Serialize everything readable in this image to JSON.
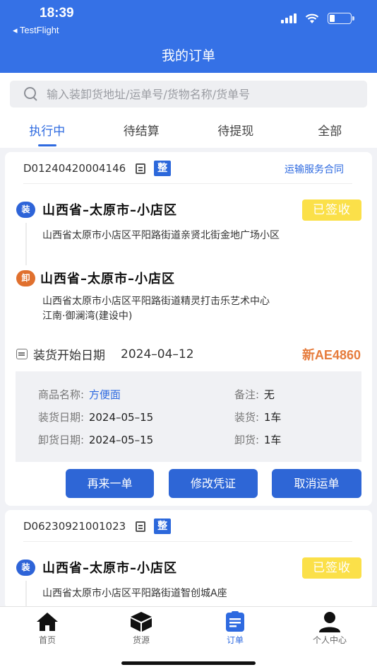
{
  "status_bar": {
    "time": "18:39",
    "back_app": "◂ TestFlight"
  },
  "header": {
    "title": "我的订单"
  },
  "search": {
    "placeholder": "输入装卸货地址/运单号/货物名称/货单号"
  },
  "tabs": [
    {
      "label": "执行中",
      "active": true
    },
    {
      "label": "待结算",
      "active": false
    },
    {
      "label": "待提现",
      "active": false
    },
    {
      "label": "全部",
      "active": false
    }
  ],
  "orders": [
    {
      "order_no": "D01240420004146",
      "type_badge": "整",
      "contract_link": "运输服务合同",
      "load": {
        "marker": "装",
        "region": "山西省–太原市–小店区",
        "address": "山西省太原市小店区平阳路街道亲贤北街金地广场小区",
        "status": "已签收"
      },
      "unload": {
        "marker": "卸",
        "region": "山西省–太原市–小店区",
        "address_line1": "山西省太原市小店区平阳路街道精灵打击乐艺术中心",
        "address_line2": "江南·御澜湾(建设中)"
      },
      "start_label": "装货开始日期",
      "start_date": "2024–04–12",
      "plate": "新AE4860",
      "details": {
        "goods_label": "商品名称:",
        "goods_value": "方便面",
        "remark_label": "备注:",
        "remark_value": "无",
        "load_date_label": "装货日期:",
        "load_date_value": "2024–05–15",
        "load_qty_label": "装货:",
        "load_qty_value": "1车",
        "unload_date_label": "卸货日期:",
        "unload_date_value": "2024–05–15",
        "unload_qty_label": "卸货:",
        "unload_qty_value": "1车"
      },
      "buttons": {
        "reorder": "再来一单",
        "edit_voucher": "修改凭证",
        "cancel": "取消运单"
      }
    },
    {
      "order_no": "D06230921001023",
      "type_badge": "整",
      "load": {
        "marker": "装",
        "region": "山西省–太原市–小店区",
        "address": "山西省太原市小店区平阳路街道智创城A座",
        "status": "已签收"
      }
    }
  ],
  "bottom_nav": [
    {
      "label": "首页",
      "icon": "home-icon"
    },
    {
      "label": "货源",
      "icon": "box-icon"
    },
    {
      "label": "订单",
      "icon": "order-icon",
      "active": true
    },
    {
      "label": "个人中心",
      "icon": "user-icon"
    }
  ],
  "colors": {
    "primary": "#3571e6",
    "accent_orange": "#e67c3c",
    "signed_yellow": "#fbe049"
  }
}
